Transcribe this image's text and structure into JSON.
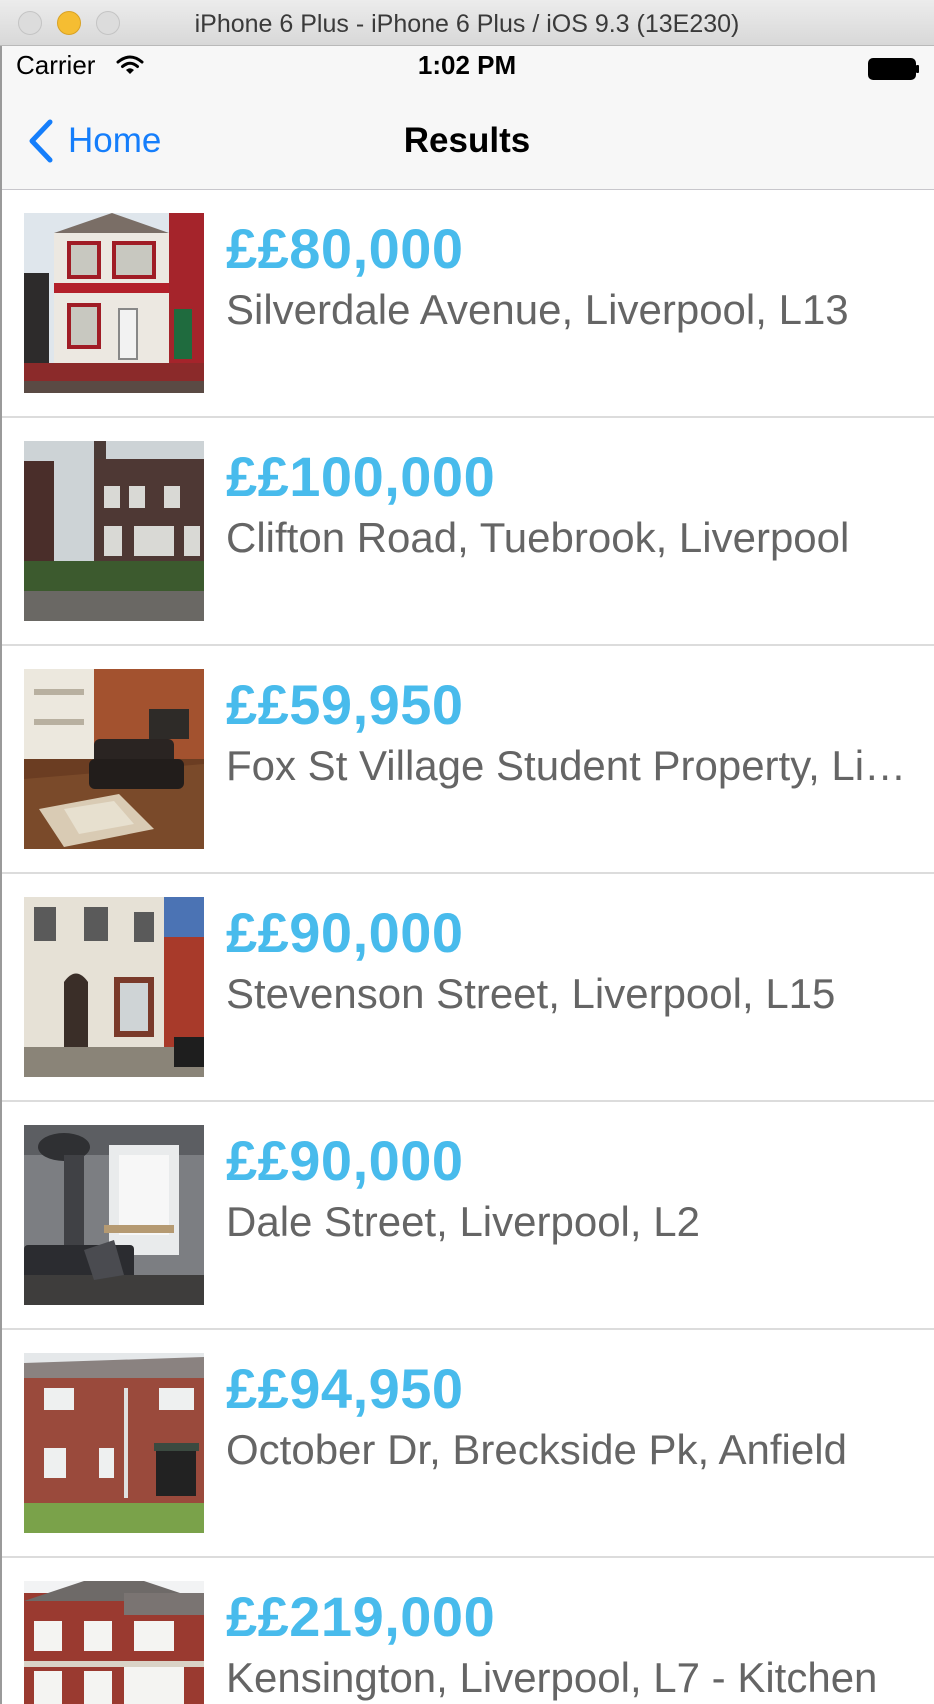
{
  "window": {
    "title": "iPhone 6 Plus - iPhone 6 Plus / iOS 9.3 (13E230)"
  },
  "status_bar": {
    "carrier": "Carrier",
    "time": "1:02 PM"
  },
  "nav": {
    "back_label": "Home",
    "title": "Results"
  },
  "colors": {
    "price": "#48bbec",
    "address": "#656565",
    "tint": "#157efb"
  },
  "results": [
    {
      "price": "££80,000",
      "address": "Silverdale Avenue, Liverpool, L13"
    },
    {
      "price": "££100,000",
      "address": "Clifton Road, Tuebrook, Liverpool"
    },
    {
      "price": "££59,950",
      "address": "Fox St Village Student Property, Liverpool"
    },
    {
      "price": "££90,000",
      "address": "Stevenson Street, Liverpool, L15"
    },
    {
      "price": "££90,000",
      "address": "Dale Street, Liverpool, L2"
    },
    {
      "price": "££94,950",
      "address": "October Dr, Breckside Pk, Anfield"
    },
    {
      "price": "££219,000",
      "address": "Kensington, Liverpool, L7 - Kitchen"
    }
  ]
}
